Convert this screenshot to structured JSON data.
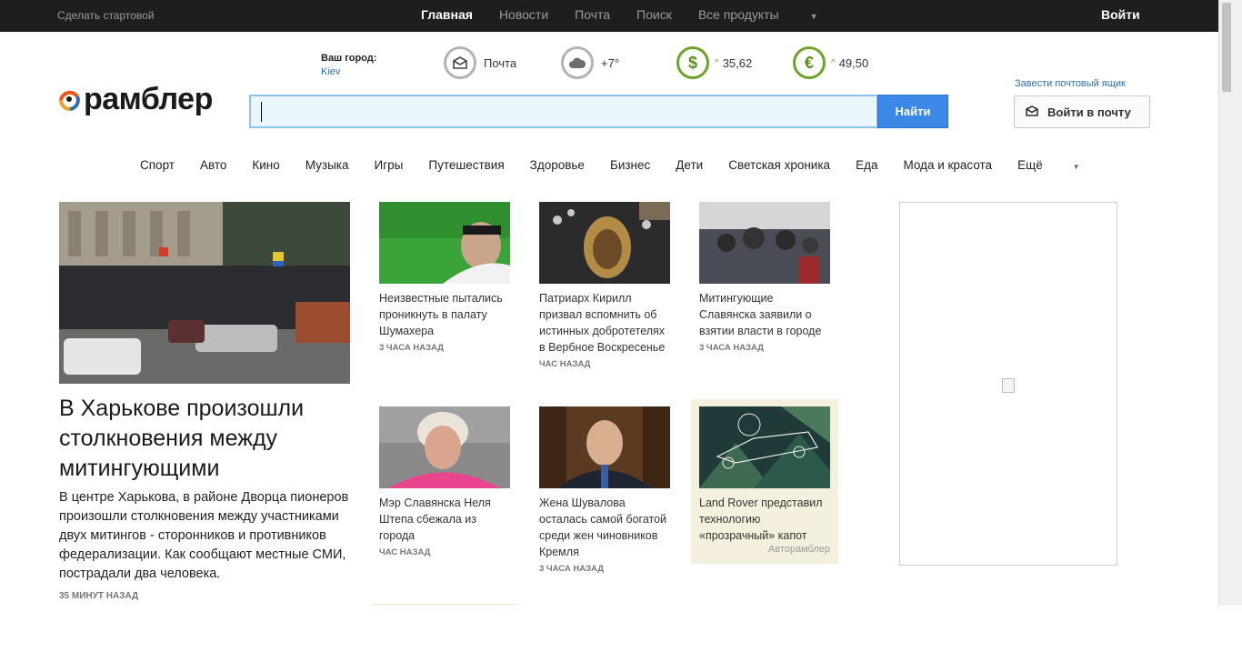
{
  "topbar": {
    "make_start": "Сделать стартовой",
    "nav": [
      "Главная",
      "Новости",
      "Почта",
      "Поиск",
      "Все продукты"
    ],
    "login": "Войти"
  },
  "header": {
    "logo_text": "рамблер",
    "city_label": "Ваш город:",
    "city_value": "Kiev",
    "mail_widget": "Почта",
    "weather": "+7°",
    "usd_symbol": "$",
    "usd_rate": "35,62",
    "eur_symbol": "€",
    "eur_rate": "49,50",
    "search_button": "Найти",
    "create_mailbox": "Завести почтовый ящик",
    "mail_login": "Войти в почту"
  },
  "categories": [
    "Спорт",
    "Авто",
    "Кино",
    "Музыка",
    "Игры",
    "Путешествия",
    "Здоровье",
    "Бизнес",
    "Дети",
    "Светская хроника",
    "Еда",
    "Мода и красота",
    "Ещё"
  ],
  "main_story": {
    "title": "В Харькове произошли столкновения между митингующими",
    "lead": "В центре Харькова, в районе Дворца пионеров произошли столкновения между участниками двух митингов - сторонников и противников федерализации. Как сообщают местные СМИ, пострадали два человека.",
    "time": "35 МИНУТ НАЗАД"
  },
  "cards": [
    {
      "title": "Неизвестные пытались проникнуть в палату Шумахера",
      "time": "3 ЧАСА НАЗАД"
    },
    {
      "title": "Патриарх Кирилл призвал вспомнить об истинных добротетелях в Вербное Воскресенье",
      "time": "ЧАС НАЗАД"
    },
    {
      "title": "Митингующие Славянска заявили о взятии власти в городе",
      "time": "3 ЧАСА НАЗАД"
    },
    {
      "title": "Мэр Славянска Неля Штепа сбежала из города",
      "time": "ЧАС НАЗАД"
    },
    {
      "title": "Жена Шувалова осталась самой богатой среди жен чиновников Кремля",
      "time": "3 ЧАСА НАЗАД"
    },
    {
      "title": "Land Rover представил технологию «прозрачный» капот",
      "source": "Авторамблер"
    }
  ],
  "colors": {
    "topbar": "#1e1e1e",
    "search_button": "#3c88e6",
    "link": "#2a6fb4",
    "currency": "#6fa327"
  }
}
